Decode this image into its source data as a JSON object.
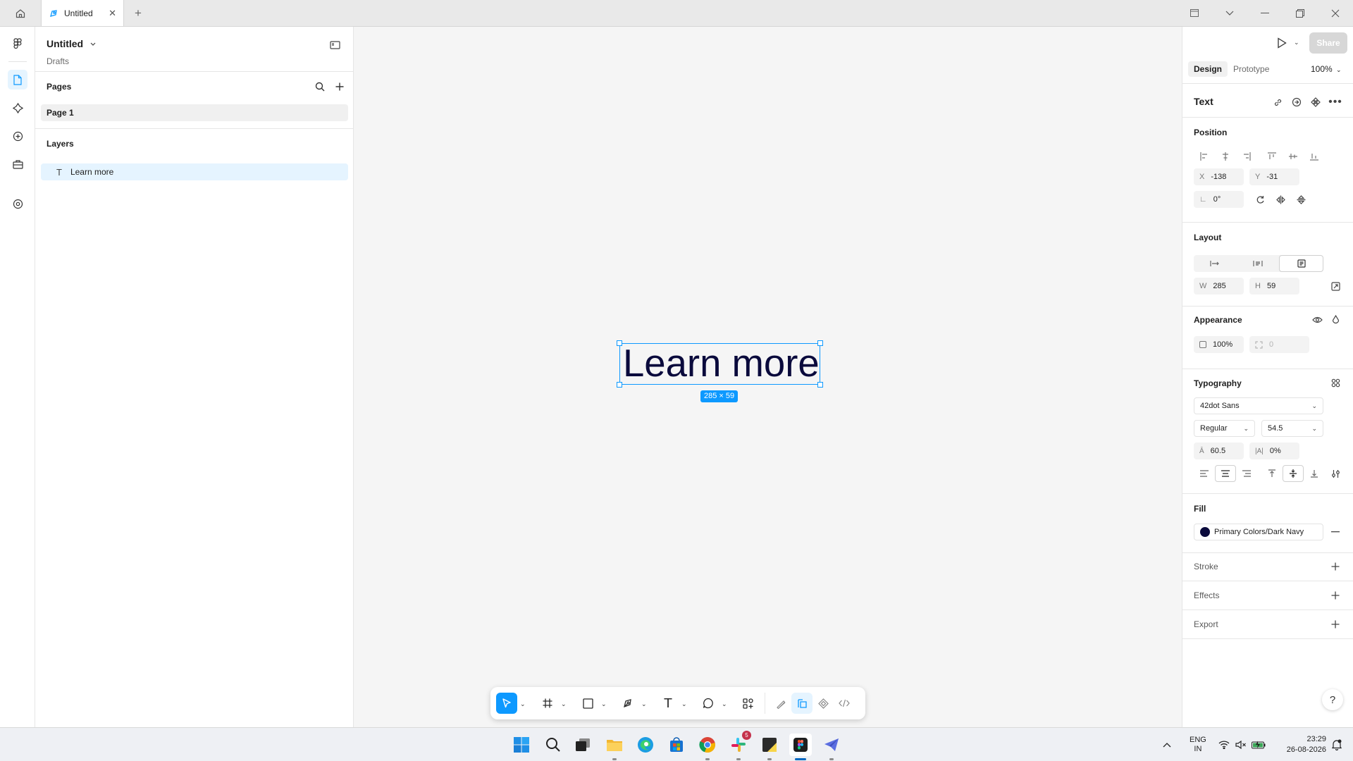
{
  "titlebar": {
    "tab_title": "Untitled"
  },
  "file": {
    "title": "Untitled",
    "location": "Drafts"
  },
  "pages": {
    "heading": "Pages",
    "items": [
      {
        "label": "Page 1"
      }
    ]
  },
  "layers": {
    "heading": "Layers",
    "items": [
      {
        "label": "Learn more",
        "type": "text"
      }
    ]
  },
  "canvas": {
    "selected_text": "Learn more",
    "size_badge": "285 × 59",
    "text_color": "#0a0a3c",
    "selection_color": "#0d99ff"
  },
  "right_panel": {
    "share_label": "Share",
    "tabs": {
      "design": "Design",
      "prototype": "Prototype"
    },
    "zoom": "100%",
    "selection_type": "Text",
    "position": {
      "heading": "Position",
      "x_label": "X",
      "x": "-138",
      "y_label": "Y",
      "y": "-31",
      "rotation": "0°"
    },
    "layout": {
      "heading": "Layout",
      "w_label": "W",
      "w": "285",
      "h_label": "H",
      "h": "59"
    },
    "appearance": {
      "heading": "Appearance",
      "opacity": "100%",
      "corner_radius": "0"
    },
    "typography": {
      "heading": "Typography",
      "font_family": "42dot Sans",
      "font_weight": "Regular",
      "font_size": "54.5",
      "line_height": "60.5",
      "letter_spacing": "0%"
    },
    "fill": {
      "heading": "Fill",
      "style_name": "Primary Colors/Dark Navy",
      "color": "#0a0a3c"
    },
    "stroke": {
      "heading": "Stroke"
    },
    "effects": {
      "heading": "Effects"
    },
    "export": {
      "heading": "Export"
    },
    "help": "?"
  },
  "taskbar": {
    "language": "ENG",
    "region": "IN",
    "time": "23:29",
    "date": "26-08-2026",
    "slack_badge": "5"
  }
}
